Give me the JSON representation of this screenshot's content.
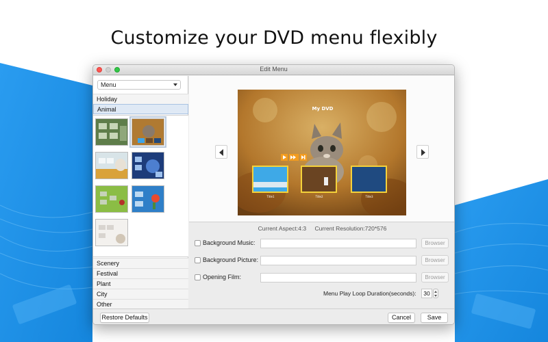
{
  "headline": "Customize your DVD menu flexibly",
  "window": {
    "title": "Edit Menu"
  },
  "left": {
    "combo_value": "Menu",
    "categories_top": [
      "Holiday",
      "Animal"
    ],
    "selected_category": "Animal",
    "categories_bottom": [
      "Scenery",
      "Festival",
      "Plant",
      "City",
      "Other"
    ]
  },
  "preview": {
    "menu_title": "My DVD",
    "chapters": [
      "Title1",
      "Title2",
      "Title3"
    ]
  },
  "info": {
    "aspect": "Current Aspect:4:3",
    "resolution": "Current Resolution:720*576"
  },
  "options": {
    "bg_music_label": "Background Music:",
    "bg_picture_label": "Background Picture:",
    "opening_film_label": "Opening Film:",
    "browse_label": "Browser",
    "loop_label": "Menu Play Loop Duration(seconds):",
    "loop_value": "30"
  },
  "buttons": {
    "restore": "Restore Defaults",
    "cancel": "Cancel",
    "save": "Save"
  },
  "colors": {
    "accent_blue": "#1a8fe3",
    "selected_category_bg": "#dfe9f5"
  }
}
